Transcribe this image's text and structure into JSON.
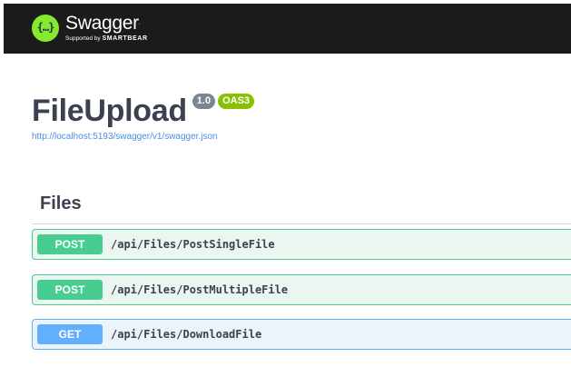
{
  "header": {
    "logo_icon": "swagger-braces-icon",
    "logo_glyph": "{…}",
    "brand_name": "Swagger",
    "brand_mark": ".",
    "supported_by": "Supported by",
    "smartbear": "SMARTBEAR",
    "colors": {
      "bar": "#1b1b1b",
      "logo": "#85ea2d"
    }
  },
  "info": {
    "title": "FileUpload",
    "version": "1.0",
    "oas_badge": "OAS3",
    "spec_url": "http://localhost:5193/swagger/v1/swagger.json"
  },
  "tags": [
    {
      "name": "Files",
      "operations": [
        {
          "method": "POST",
          "path": "/api/Files/PostSingleFile",
          "color": "#49cc90"
        },
        {
          "method": "POST",
          "path": "/api/Files/PostMultipleFile",
          "color": "#49cc90"
        },
        {
          "method": "GET",
          "path": "/api/Files/DownloadFile",
          "color": "#61affe"
        }
      ]
    }
  ]
}
